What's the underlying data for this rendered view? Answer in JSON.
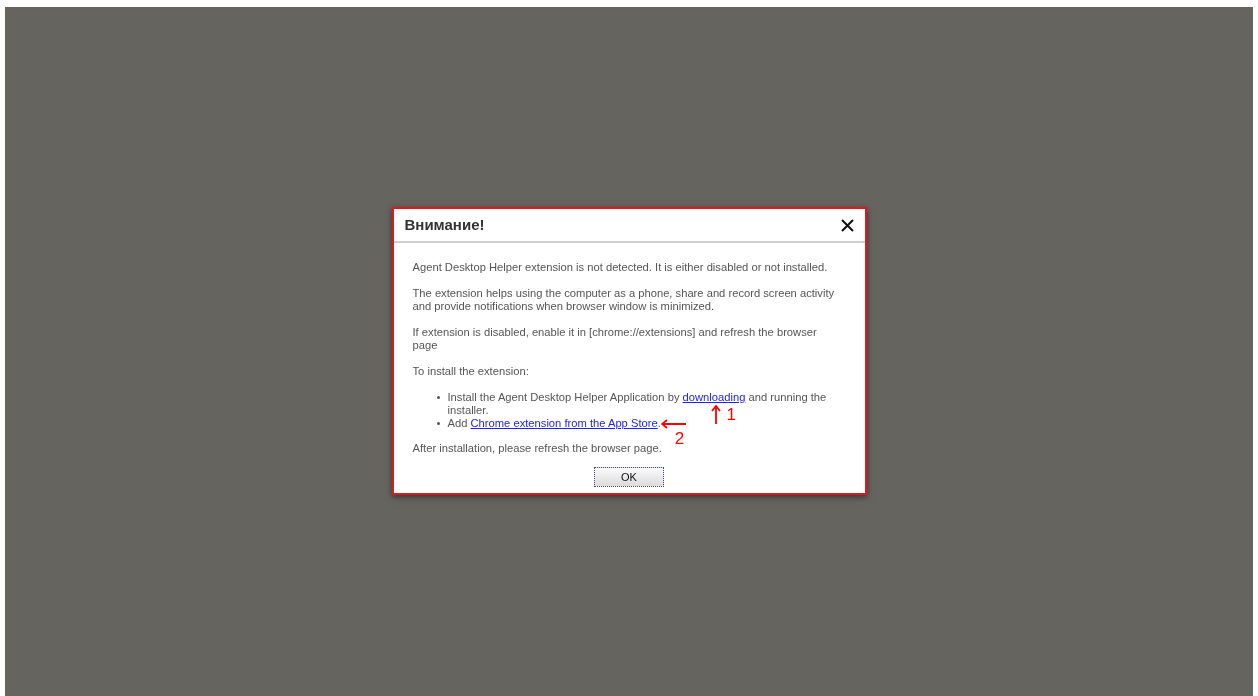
{
  "dialog": {
    "title": "Внимание!",
    "paragraphs": [
      "Agent Desktop Helper extension is not detected. It is either disabled or not installed.",
      "The extension helps using the computer as a phone, share and record screen activity and provide notifications when browser window is minimized.",
      "If extension is disabled, enable it in [chrome://extensions] and refresh the browser page",
      "To install the extension:"
    ],
    "steps": [
      {
        "before": "Install the Agent Desktop Helper Application by ",
        "link": "downloading",
        "after": " and running the installer.",
        "annotation": "1",
        "kind": "up"
      },
      {
        "before": "Add ",
        "link": "Chrome extension from the App Store",
        "after": ".",
        "annotation": "2",
        "kind": "left"
      }
    ],
    "footer": "After installation, please refresh the browser page.",
    "button": "OK"
  }
}
